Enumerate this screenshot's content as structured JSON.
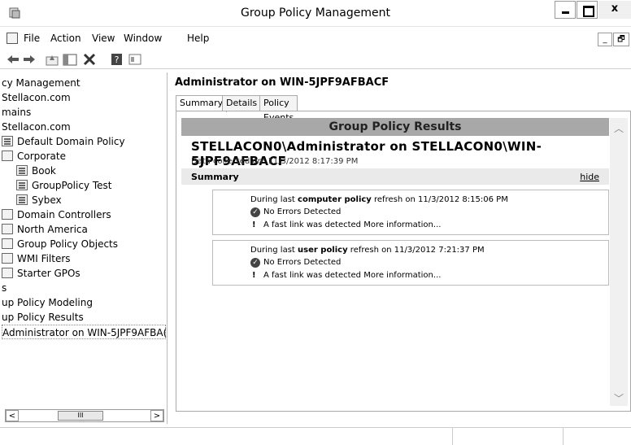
{
  "window": {
    "title": "Group Policy Management",
    "close_glyph": "x"
  },
  "menu": {
    "items": [
      "File",
      "Action",
      "View",
      "Window",
      "Help"
    ]
  },
  "toolbar": {
    "icons": [
      "back-arrow-icon",
      "forward-arrow-icon",
      "up-folder-icon",
      "show-hide-tree-icon",
      "delete-icon",
      "help-icon",
      "properties-icon"
    ]
  },
  "tree": {
    "items": [
      {
        "label": "cy Management",
        "icon": "none"
      },
      {
        "label": "Stellacon.com",
        "icon": "none"
      },
      {
        "label": "mains",
        "icon": "none"
      },
      {
        "label": "Stellacon.com",
        "icon": "none"
      },
      {
        "label": "Default Domain Policy",
        "icon": "gpo-link-icon"
      },
      {
        "label": "Corporate",
        "icon": "ou-icon"
      },
      {
        "label": "Book",
        "icon": "gpo-link-icon"
      },
      {
        "label": "GroupPolicy Test",
        "icon": "gpo-link-icon"
      },
      {
        "label": "Sybex",
        "icon": "gpo-link-icon"
      },
      {
        "label": "Domain Controllers",
        "icon": "ou-icon"
      },
      {
        "label": "North America",
        "icon": "ou-icon"
      },
      {
        "label": "Group Policy Objects",
        "icon": "folder-icon"
      },
      {
        "label": "WMI Filters",
        "icon": "folder-icon"
      },
      {
        "label": "Starter GPOs",
        "icon": "folder-icon"
      },
      {
        "label": "s",
        "icon": "none"
      },
      {
        "label": "up Policy Modeling",
        "icon": "none"
      },
      {
        "label": "up Policy Results",
        "icon": "none"
      },
      {
        "label": "Administrator on WIN-5JPF9AFBA(",
        "icon": "none"
      }
    ],
    "scroll_thumb": "III",
    "scroll_left": "<",
    "scroll_right": ">"
  },
  "main": {
    "heading": "Administrator on WIN-5JPF9AFBACF",
    "tabs": [
      "Summary",
      "Details",
      "Policy Events"
    ],
    "active_tab": "Summary",
    "results_header": "Group Policy Results",
    "user_line": "STELLACON0\\Administrator on STELLACON0\\WIN-5JPF9AFBACF",
    "collected": "Data collected on: 11/3/2012 8:17:39 PM",
    "summary_label": "Summary",
    "hide_link": "hide",
    "computer": {
      "pre": "During last ",
      "bold": "computer policy",
      "post": " refresh on 11/3/2012 8:15:06 PM",
      "status": "No Errors Detected",
      "note": "A fast link was detected More information..."
    },
    "user": {
      "pre": "During last ",
      "bold": "user policy",
      "post": " refresh on 11/3/2012 7:21:37 PM",
      "status": "No Errors Detected",
      "note": "A fast link was detected More information..."
    }
  }
}
